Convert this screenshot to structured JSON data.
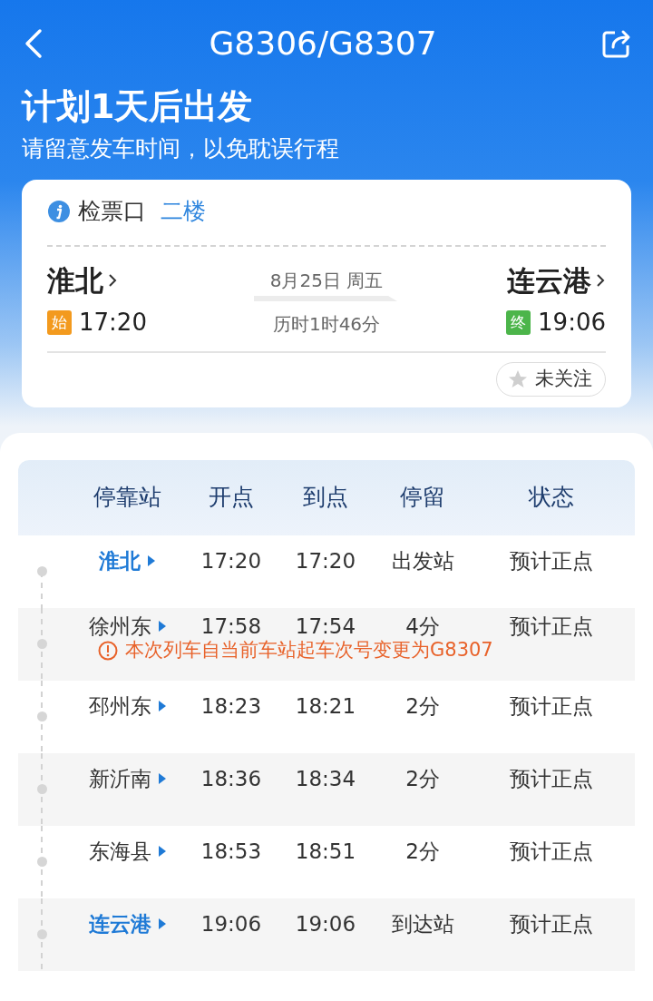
{
  "header": {
    "title": "G8306/G8307"
  },
  "banner": {
    "headline": "计划1天后出发",
    "subtitle": "请留意发车时间，以免耽误行程"
  },
  "card": {
    "gate_label": "检票口",
    "gate": "二楼",
    "from": {
      "station": "淮北",
      "badge": "始",
      "time": "17:20"
    },
    "to": {
      "station": "连云港",
      "badge": "终",
      "time": "19:06"
    },
    "date": "8月25日 周五",
    "duration": "历时1时46分",
    "follow": {
      "label": "未关注",
      "followed": false
    }
  },
  "table": {
    "columns": [
      "停靠站",
      "开点",
      "到点",
      "停留",
      "状态"
    ],
    "rows": [
      {
        "kind": "origin",
        "station": "淮北",
        "depart": "17:20",
        "arrive": "17:20",
        "stop": "出发站",
        "status": "预计正点"
      },
      {
        "kind": "stop",
        "station": "徐州东",
        "depart": "17:58",
        "arrive": "17:54",
        "stop": "4分",
        "status": "预计正点",
        "notice": "本次列车自当前车站起车次号变更为G8307"
      },
      {
        "kind": "stop",
        "station": "邳州东",
        "depart": "18:23",
        "arrive": "18:21",
        "stop": "2分",
        "status": "预计正点"
      },
      {
        "kind": "stop",
        "station": "新沂南",
        "depart": "18:36",
        "arrive": "18:34",
        "stop": "2分",
        "status": "预计正点"
      },
      {
        "kind": "stop",
        "station": "东海县",
        "depart": "18:53",
        "arrive": "18:51",
        "stop": "2分",
        "status": "预计正点"
      },
      {
        "kind": "terminal",
        "station": "连云港",
        "depart": "19:06",
        "arrive": "19:06",
        "stop": "到达站",
        "status": "预计正点"
      }
    ]
  }
}
